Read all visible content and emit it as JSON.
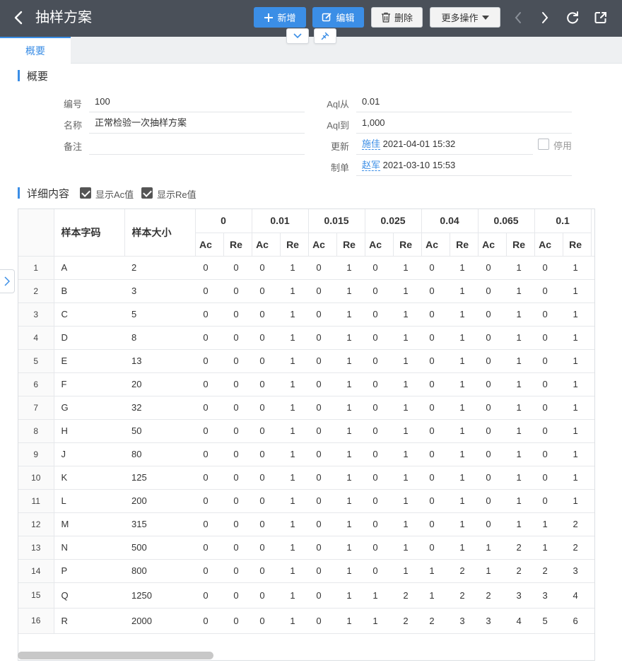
{
  "header": {
    "title": "抽样方案",
    "buttons": {
      "add": "新增",
      "edit": "编辑",
      "delete": "删除",
      "more": "更多操作"
    }
  },
  "tabs": [
    {
      "label": "概要",
      "active": true
    }
  ],
  "overview": {
    "heading": "概要",
    "fields": {
      "code": {
        "label": "编号",
        "value": "100"
      },
      "name": {
        "label": "名称",
        "value": "正常检验一次抽样方案"
      },
      "remark": {
        "label": "备注",
        "value": ""
      },
      "aql_from": {
        "label": "Aql从",
        "value": "0.01"
      },
      "aql_to": {
        "label": "Aql到",
        "value": "1,000"
      },
      "updated": {
        "label": "更新",
        "user": "施佳",
        "time": "2021-04-01 15:32"
      },
      "created": {
        "label": "制单",
        "user": "赵军",
        "time": "2021-03-10 15:53"
      },
      "disabled": {
        "label": "停用",
        "checked": false
      }
    }
  },
  "details": {
    "heading": "详细内容",
    "show_ac": {
      "label": "显示Ac值",
      "checked": true
    },
    "show_re": {
      "label": "显示Re值",
      "checked": true
    },
    "columns": {
      "code": "样本字码",
      "size": "样本大小",
      "ac": "Ac",
      "re": "Re"
    },
    "aql_levels": [
      "0",
      "0.01",
      "0.015",
      "0.025",
      "0.04",
      "0.065",
      "0.1"
    ],
    "rows": [
      {
        "n": "1",
        "code": "A",
        "size": "2",
        "vals": [
          "0",
          "0",
          "0",
          "1",
          "0",
          "1",
          "0",
          "1",
          "0",
          "1",
          "0",
          "1",
          "0",
          "1"
        ]
      },
      {
        "n": "2",
        "code": "B",
        "size": "3",
        "vals": [
          "0",
          "0",
          "0",
          "1",
          "0",
          "1",
          "0",
          "1",
          "0",
          "1",
          "0",
          "1",
          "0",
          "1"
        ]
      },
      {
        "n": "3",
        "code": "C",
        "size": "5",
        "vals": [
          "0",
          "0",
          "0",
          "1",
          "0",
          "1",
          "0",
          "1",
          "0",
          "1",
          "0",
          "1",
          "0",
          "1"
        ]
      },
      {
        "n": "4",
        "code": "D",
        "size": "8",
        "vals": [
          "0",
          "0",
          "0",
          "1",
          "0",
          "1",
          "0",
          "1",
          "0",
          "1",
          "0",
          "1",
          "0",
          "1"
        ]
      },
      {
        "n": "5",
        "code": "E",
        "size": "13",
        "vals": [
          "0",
          "0",
          "0",
          "1",
          "0",
          "1",
          "0",
          "1",
          "0",
          "1",
          "0",
          "1",
          "0",
          "1"
        ]
      },
      {
        "n": "6",
        "code": "F",
        "size": "20",
        "vals": [
          "0",
          "0",
          "0",
          "1",
          "0",
          "1",
          "0",
          "1",
          "0",
          "1",
          "0",
          "1",
          "0",
          "1"
        ]
      },
      {
        "n": "7",
        "code": "G",
        "size": "32",
        "vals": [
          "0",
          "0",
          "0",
          "1",
          "0",
          "1",
          "0",
          "1",
          "0",
          "1",
          "0",
          "1",
          "0",
          "1"
        ]
      },
      {
        "n": "8",
        "code": "H",
        "size": "50",
        "vals": [
          "0",
          "0",
          "0",
          "1",
          "0",
          "1",
          "0",
          "1",
          "0",
          "1",
          "0",
          "1",
          "0",
          "1"
        ]
      },
      {
        "n": "9",
        "code": "J",
        "size": "80",
        "vals": [
          "0",
          "0",
          "0",
          "1",
          "0",
          "1",
          "0",
          "1",
          "0",
          "1",
          "0",
          "1",
          "0",
          "1"
        ]
      },
      {
        "n": "10",
        "code": "K",
        "size": "125",
        "vals": [
          "0",
          "0",
          "0",
          "1",
          "0",
          "1",
          "0",
          "1",
          "0",
          "1",
          "0",
          "1",
          "0",
          "1"
        ]
      },
      {
        "n": "11",
        "code": "L",
        "size": "200",
        "vals": [
          "0",
          "0",
          "0",
          "1",
          "0",
          "1",
          "0",
          "1",
          "0",
          "1",
          "0",
          "1",
          "0",
          "1"
        ]
      },
      {
        "n": "12",
        "code": "M",
        "size": "315",
        "vals": [
          "0",
          "0",
          "0",
          "1",
          "0",
          "1",
          "0",
          "1",
          "0",
          "1",
          "0",
          "1",
          "1",
          "2"
        ]
      },
      {
        "n": "13",
        "code": "N",
        "size": "500",
        "vals": [
          "0",
          "0",
          "0",
          "1",
          "0",
          "1",
          "0",
          "1",
          "0",
          "1",
          "1",
          "2",
          "1",
          "2"
        ]
      },
      {
        "n": "14",
        "code": "P",
        "size": "800",
        "vals": [
          "0",
          "0",
          "0",
          "1",
          "0",
          "1",
          "0",
          "1",
          "1",
          "2",
          "1",
          "2",
          "2",
          "3"
        ]
      },
      {
        "n": "15",
        "code": "Q",
        "size": "1250",
        "vals": [
          "0",
          "0",
          "0",
          "1",
          "0",
          "1",
          "1",
          "2",
          "1",
          "2",
          "2",
          "3",
          "3",
          "4"
        ]
      },
      {
        "n": "16",
        "code": "R",
        "size": "2000",
        "vals": [
          "0",
          "0",
          "0",
          "1",
          "0",
          "1",
          "1",
          "2",
          "2",
          "3",
          "3",
          "4",
          "5",
          "6"
        ]
      }
    ]
  },
  "colors": {
    "header_bg": "#4a5059",
    "accent": "#3b8ee6"
  }
}
